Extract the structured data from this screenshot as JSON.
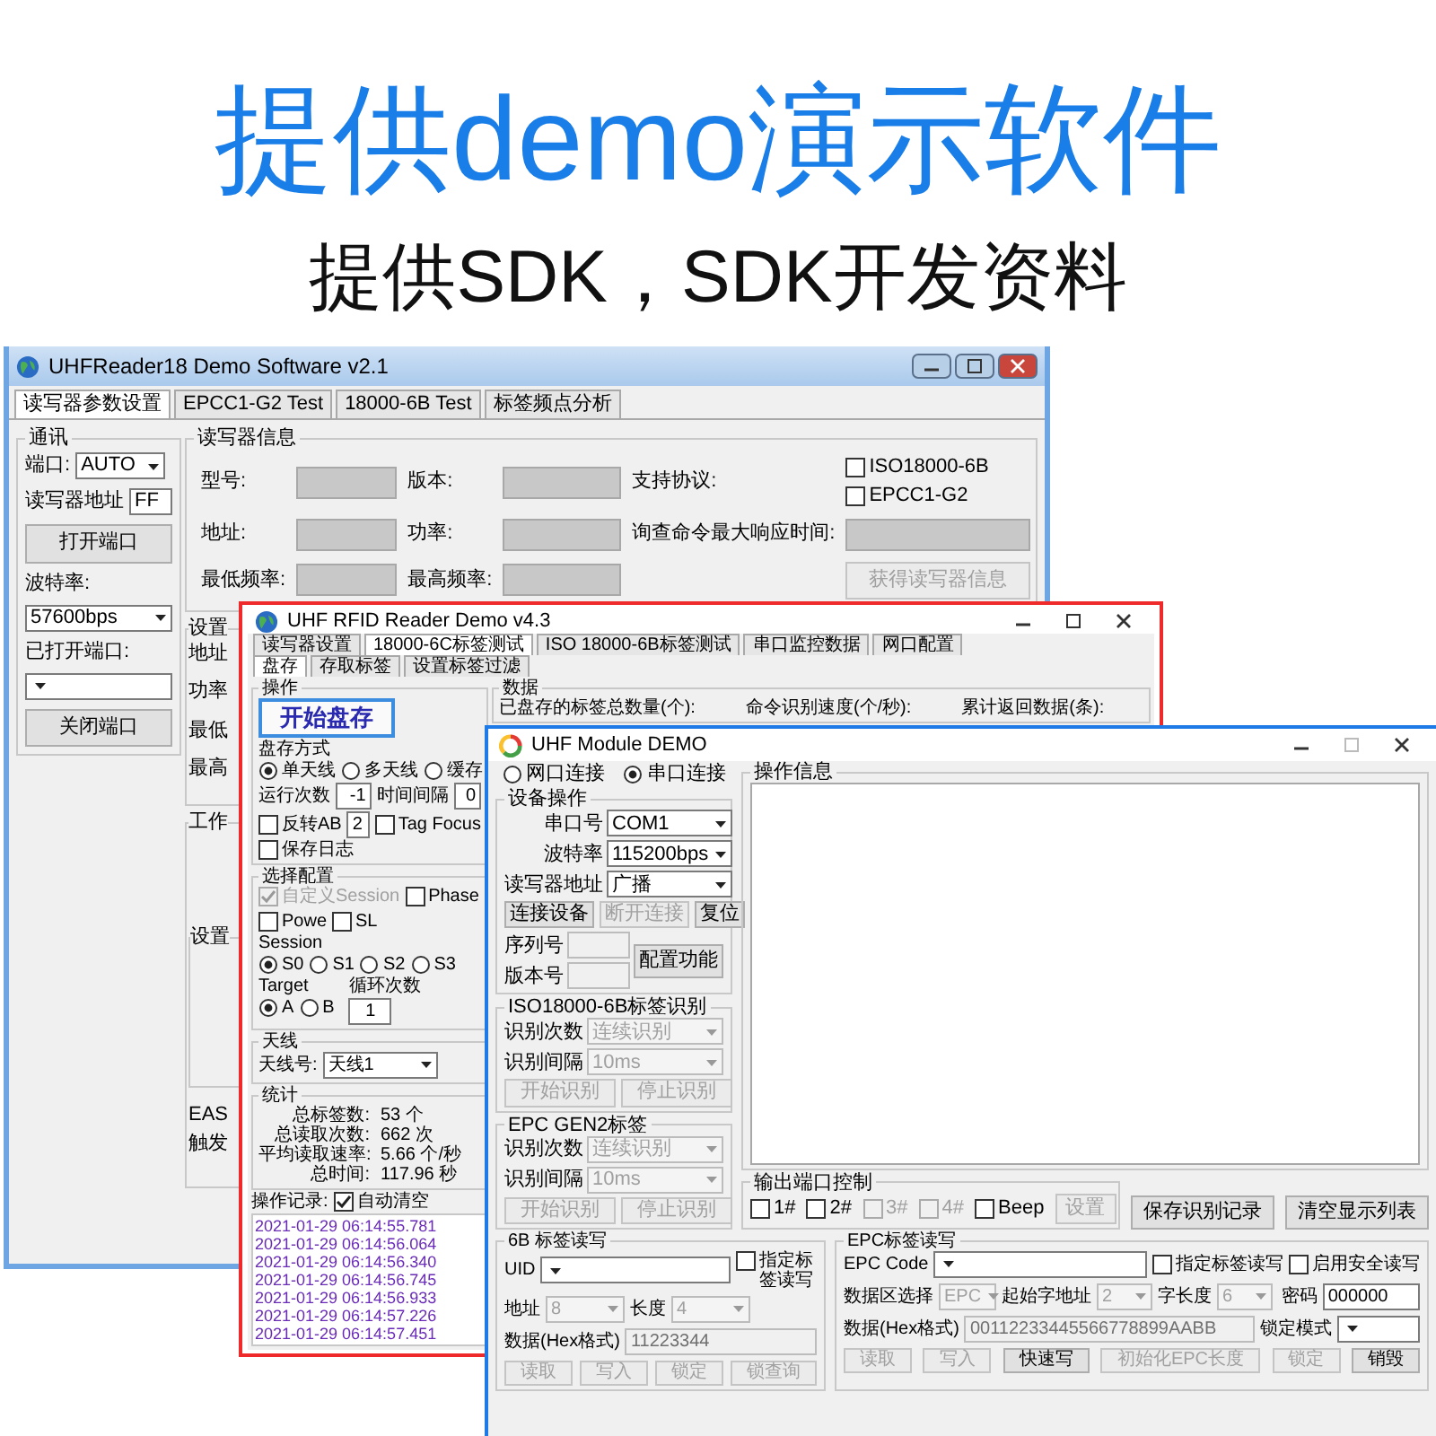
{
  "headline": "提供demo演示软件",
  "subheadline": "提供SDK，SDK开发资料",
  "window_1": {
    "title": "UHFReader18 Demo Software v2.1",
    "tabs": [
      {
        "label": "读写器参数设置",
        "selected": true
      },
      {
        "label": "EPCC1-G2 Test",
        "selected": false
      },
      {
        "label": "18000-6B Test",
        "selected": false
      },
      {
        "label": "标签频点分析",
        "selected": false
      }
    ],
    "comm": {
      "title": "通讯",
      "port_label": "端口:",
      "port": "AUTO",
      "address_label": "读写器地址",
      "address": "FF",
      "open_button": "打开端口",
      "baud_label": "波特率:",
      "baud": "57600bps",
      "opened_label": "已打开端口:",
      "close_button": "关闭端口"
    },
    "info": {
      "title": "读写器信息",
      "fields": [
        {
          "label": "型号:"
        },
        {
          "label": "版本:"
        },
        {
          "label": "地址:"
        },
        {
          "label": "功率:"
        },
        {
          "label": "最低频率:"
        },
        {
          "label": "最高频率:"
        }
      ],
      "protocol_label": "支持协议:",
      "protocols": [
        {
          "label": "ISO18000-6B",
          "checked": false
        },
        {
          "label": "EPCC1-G2",
          "checked": false
        }
      ],
      "response_label": "询查命令最大响应时间:",
      "get_button": "获得读写器信息"
    },
    "settings": {
      "title": "设置",
      "labels": [
        "地址",
        "功率",
        "最低",
        "最高"
      ]
    },
    "work": {
      "title": "工作",
      "settings_title": "设置",
      "labels": [
        "EAS",
        "触发"
      ]
    }
  },
  "window_2": {
    "title": "UHF RFID Reader Demo v4.3",
    "tabs": [
      {
        "label": "读写器设置",
        "selected": false
      },
      {
        "label": "18000-6C标签测试",
        "selected": true
      },
      {
        "label": "ISO 18000-6B标签测试",
        "selected": false
      },
      {
        "label": "串口监控数据",
        "selected": false
      },
      {
        "label": "网口配置",
        "selected": false
      }
    ],
    "subtabs": [
      {
        "label": "盘存",
        "selected": true
      },
      {
        "label": "存取标签",
        "selected": false
      },
      {
        "label": "设置标签过滤",
        "selected": false
      }
    ],
    "operation": {
      "title": "操作",
      "start_button": "开始盘存",
      "mode_label": "盘存方式",
      "modes": [
        {
          "label": "单天线",
          "selected": true
        },
        {
          "label": "多天线",
          "selected": false
        },
        {
          "label": "缓存",
          "selected": false
        }
      ],
      "run_count_label": "运行次数",
      "run_count": "-1",
      "interval_label": "时间间隔",
      "interval": "0",
      "options": [
        {
          "label": "反转AB",
          "checked": false
        },
        {
          "label": "Tag Focus",
          "checked": false
        },
        {
          "label": "保存日志",
          "checked": false
        }
      ],
      "reverse_ab_value": "2"
    },
    "select": {
      "title": "选择配置",
      "options": [
        {
          "label": "自定义Session",
          "checked": true,
          "disabled": true
        },
        {
          "label": "Phase",
          "checked": false,
          "disabled": false
        },
        {
          "label": "Powe",
          "checked": false,
          "disabled": false
        },
        {
          "label": "SL",
          "checked": false,
          "disabled": false
        }
      ],
      "session_label": "Session",
      "sessions": [
        {
          "label": "S0",
          "selected": true
        },
        {
          "label": "S1",
          "selected": false
        },
        {
          "label": "S2",
          "selected": false
        },
        {
          "label": "S3",
          "selected": false
        }
      ],
      "target_label": "Target",
      "targets": [
        {
          "label": "A",
          "selected": true
        },
        {
          "label": "B",
          "selected": false
        }
      ],
      "loop_label": "循环次数",
      "loop": "1"
    },
    "antenna": {
      "title": "天线",
      "label": "天线号:",
      "value": "天线1"
    },
    "stats": {
      "title": "统计",
      "rows": [
        {
          "label": "总标签数:",
          "value": "53 个"
        },
        {
          "label": "总读取次数:",
          "value": "662 次"
        },
        {
          "label": "平均读取速率:",
          "value": "5.66 个/秒"
        },
        {
          "label": "总时间:",
          "value": "117.96 秒"
        }
      ]
    },
    "log": {
      "label": "操作记录:",
      "auto_clear": {
        "label": "自动清空",
        "checked": true
      },
      "lines": [
        "2021-01-29 06:14:55.781",
        "2021-01-29 06:14:56.064",
        "2021-01-29 06:14:56.340",
        "2021-01-29 06:14:56.745",
        "2021-01-29 06:14:56.933",
        "2021-01-29 06:14:57.226",
        "2021-01-29 06:14:57.451"
      ]
    },
    "data": {
      "title": "数据",
      "labels": [
        "已盘存的标签总数量(个):",
        "命令识别速度(个/秒):",
        "累计返回数据(条):"
      ]
    }
  },
  "window_3": {
    "title": "UHF Module DEMO",
    "connections": [
      {
        "label": "网口连接",
        "selected": false
      },
      {
        "label": "串口连接",
        "selected": true
      }
    ],
    "device": {
      "title": "设备操作",
      "fields": [
        {
          "label": "串口号",
          "value": "COM1"
        },
        {
          "label": "波特率",
          "value": "115200bps"
        },
        {
          "label": "读写器地址",
          "value": "广播"
        }
      ],
      "buttons": [
        {
          "label": "连接设备",
          "disabled": false
        },
        {
          "label": "断开连接",
          "disabled": true
        },
        {
          "label": "复位",
          "disabled": false
        }
      ],
      "info_labels": [
        "序列号",
        "版本号"
      ],
      "config_button": "配置功能"
    },
    "iso": {
      "title": "ISO18000-6B标签识别",
      "fields": [
        {
          "label": "识别次数",
          "value": "连续识别",
          "disabled": true
        },
        {
          "label": "识别间隔",
          "value": "10ms",
          "disabled": true
        }
      ],
      "buttons": [
        {
          "label": "开始识别",
          "disabled": true
        },
        {
          "label": "停止识别",
          "disabled": true
        }
      ]
    },
    "gen2": {
      "title": "EPC GEN2标签",
      "fields": [
        {
          "label": "识别次数",
          "value": "连续识别",
          "disabled": true
        },
        {
          "label": "识别间隔",
          "value": "10ms",
          "disabled": true
        }
      ],
      "buttons": [
        {
          "label": "开始识别",
          "disabled": true
        },
        {
          "label": "停止识别",
          "disabled": true
        }
      ]
    },
    "messages": {
      "title": "操作信息"
    },
    "output": {
      "title": "输出端口控制",
      "ports": [
        {
          "label": "1#",
          "checked": false,
          "disabled": false
        },
        {
          "label": "2#",
          "checked": false,
          "disabled": false
        },
        {
          "label": "3#",
          "checked": false,
          "disabled": true
        },
        {
          "label": "4#",
          "checked": false,
          "disabled": true
        },
        {
          "label": "Beep",
          "checked": false,
          "disabled": false
        }
      ],
      "set_button": {
        "label": "设置",
        "disabled": true
      }
    },
    "actions": [
      {
        "label": "保存识别记录",
        "disabled": false
      },
      {
        "label": "清空显示列表",
        "disabled": false
      }
    ],
    "tag_6b": {
      "title": "6B 标签读写",
      "uid": {
        "label": "UID",
        "disabled": false
      },
      "specify": {
        "label": "指定标签读写",
        "checked": false
      },
      "fields": [
        {
          "label": "地址",
          "value": "8",
          "disabled": true
        },
        {
          "label": "长度",
          "value": "4",
          "disabled": true
        }
      ],
      "data": {
        "label": "数据(Hex格式)",
        "value": "11223344",
        "disabled": true
      },
      "buttons": [
        {
          "label": "读取",
          "disabled": true
        },
        {
          "label": "写入",
          "disabled": true
        },
        {
          "label": "锁定",
          "disabled": true
        },
        {
          "label": "锁查询",
          "disabled": true
        }
      ]
    },
    "tag_epc": {
      "title": "EPC标签读写",
      "code": {
        "label": "EPC Code",
        "disabled": false
      },
      "options": [
        {
          "label": "指定标签读写",
          "checked": false
        },
        {
          "label": "启用安全读写",
          "checked": false
        }
      ],
      "fields": [
        {
          "label": "数据区选择",
          "value": "EPC",
          "disabled": true
        },
        {
          "label": "起始字地址",
          "value": "2",
          "disabled": true
        },
        {
          "label": "字长度",
          "value": "6",
          "disabled": true
        }
      ],
      "password": {
        "label": "密码",
        "value": "000000",
        "disabled": false
      },
      "data": {
        "label": "数据(Hex格式)",
        "value": "00112233445566778899AABB",
        "disabled": true
      },
      "lock": {
        "label": "锁定模式",
        "disabled": false
      },
      "buttons": [
        {
          "label": "读取",
          "disabled": true
        },
        {
          "label": "写入",
          "disabled": true
        },
        {
          "label": "快速写",
          "disabled": false
        },
        {
          "label": "初始化EPC长度",
          "disabled": true
        },
        {
          "label": "锁定",
          "disabled": true
        },
        {
          "label": "销毁",
          "disabled": false
        }
      ]
    }
  }
}
